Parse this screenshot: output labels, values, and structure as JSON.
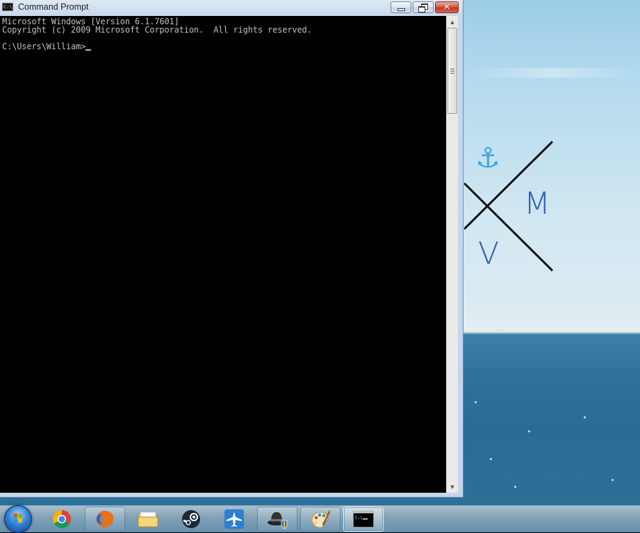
{
  "window": {
    "title": "Command Prompt",
    "minimize_label": "",
    "maximize_label": "",
    "close_label": "✕"
  },
  "console": {
    "lines": [
      "Microsoft Windows [Version 6.1.7601]",
      "Copyright (c) 2009 Microsoft Corporation.  All rights reserved.",
      "",
      "C:\\Users\\William>"
    ]
  },
  "wallpaper": {
    "letters": [
      "M",
      "V"
    ],
    "icon": "anchor-icon",
    "colors": {
      "letters": "#2d5fb5",
      "anchor": "#3aa6d6",
      "lines": "#111111"
    }
  },
  "taskbar": {
    "items": [
      {
        "name": "chrome",
        "icon": "chrome-icon",
        "state": "pinned"
      },
      {
        "name": "firefox",
        "icon": "firefox-icon",
        "state": "running"
      },
      {
        "name": "explorer",
        "icon": "folder-icon",
        "state": "pinned"
      },
      {
        "name": "steam",
        "icon": "steam-icon",
        "state": "pinned"
      },
      {
        "name": "airplane-app",
        "icon": "airplane-icon",
        "state": "pinned"
      },
      {
        "name": "hat-app",
        "icon": "hat-shield-icon",
        "state": "running"
      },
      {
        "name": "paint",
        "icon": "paint-palette-icon",
        "state": "running"
      },
      {
        "name": "cmd",
        "icon": "cmd-icon",
        "state": "active"
      }
    ]
  }
}
